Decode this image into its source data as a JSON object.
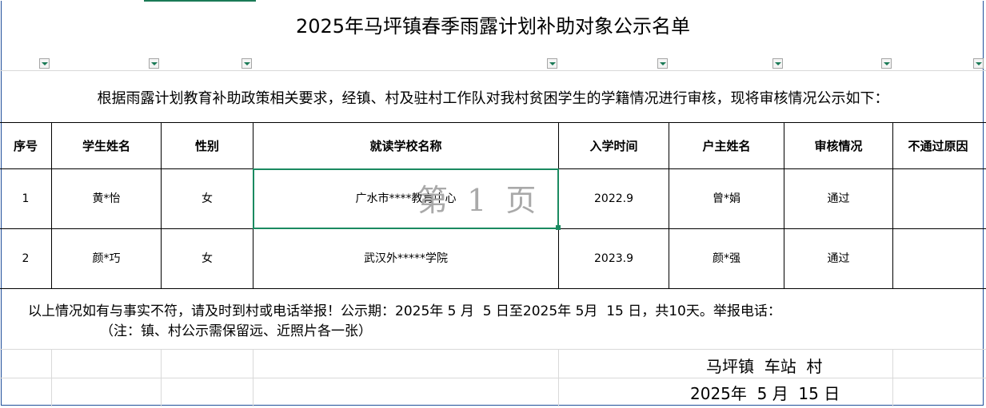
{
  "title": "2025年马坪镇春季雨露计划补助对象公示名单",
  "intro": "根据雨露计划教育补助政策相关要求，经镇、村及驻村工作队对我村贫困学生的学籍情况进行审核，现将审核情况公示如下：",
  "table": {
    "headers": [
      "序号",
      "学生姓名",
      "性别",
      "就读学校名称",
      "入学时间",
      "户主姓名",
      "审核情况",
      "不通过原因"
    ],
    "rows": [
      [
        "1",
        "黄*怡",
        "女",
        "广水市****教育中心",
        "2022.9",
        "曾*娟",
        "通过",
        ""
      ],
      [
        "2",
        "颜*巧",
        "女",
        "武汉外*****学院",
        "2023.9",
        "颜*强",
        "通过",
        ""
      ]
    ]
  },
  "watermark": "第 1 页",
  "footer": {
    "line1": "以上情况如有与事实不符，请及时到村或电话举报！公示期：2025年 5 月  5 日至2025年 5月  15 日，共10天。举报电话：",
    "line2": "（注：镇、村公示需保留远、近照片各一张）",
    "signature": "马坪镇  车站  村",
    "date": "2025年  5 月  15 日"
  },
  "colors": {
    "selection": "#1a8a60",
    "frame": "#1f4e9a",
    "watermark": "#a9a9a9"
  }
}
